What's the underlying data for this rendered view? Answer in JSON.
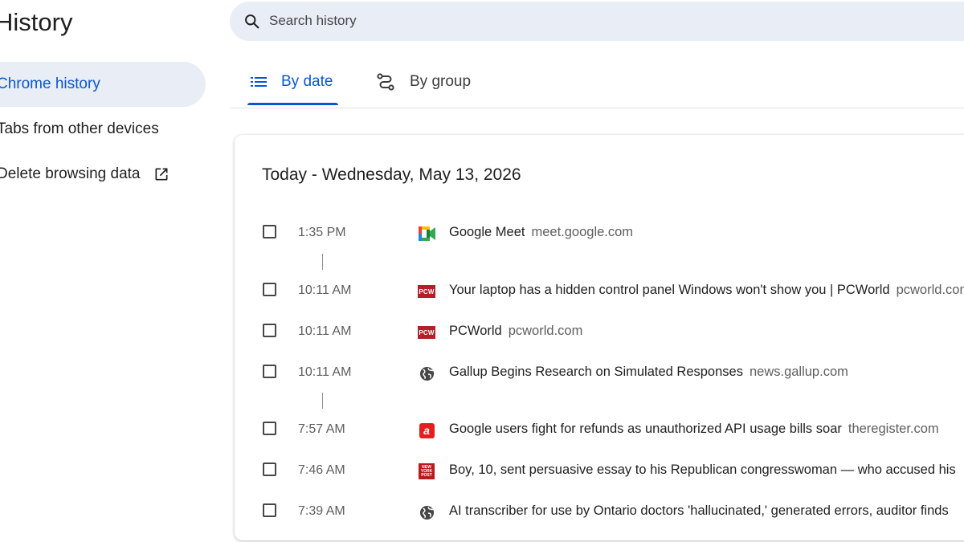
{
  "app": {
    "title": "History"
  },
  "sidebar": {
    "items": [
      {
        "label": "Chrome history",
        "active": true
      },
      {
        "label": "Tabs from other devices",
        "active": false
      },
      {
        "label": "Delete browsing data",
        "active": false,
        "icon": "open-in-new-icon"
      }
    ]
  },
  "search": {
    "placeholder": "Search history",
    "value": ""
  },
  "tabs": [
    {
      "label": "By date",
      "icon": "list-icon",
      "active": true
    },
    {
      "label": "By group",
      "icon": "route-icon",
      "active": false
    }
  ],
  "history": {
    "date_heading": "Today - Wednesday, May 13, 2026",
    "entries": [
      {
        "time": "1:35 PM",
        "title": "Google Meet",
        "domain": "meet.google.com",
        "favicon": "google-meet-icon"
      },
      {
        "time": "10:11 AM",
        "title": "Your laptop has a hidden control panel Windows won't show you | PCWorld",
        "domain": "pcworld.com",
        "favicon": "pcworld-icon"
      },
      {
        "time": "10:11 AM",
        "title": "PCWorld",
        "domain": "pcworld.com",
        "favicon": "pcworld-icon"
      },
      {
        "time": "10:11 AM",
        "title": "Gallup Begins Research on Simulated Responses",
        "domain": "news.gallup.com",
        "favicon": "globe-icon"
      },
      {
        "time": "7:57 AM",
        "title": "Google users fight for refunds as unauthorized API usage bills soar",
        "domain": "theregister.com",
        "favicon": "the-register-icon"
      },
      {
        "time": "7:46 AM",
        "title": "Boy, 10, sent persuasive essay to his Republican congresswoman — who accused his",
        "domain": "",
        "favicon": "new-york-post-icon"
      },
      {
        "time": "7:39 AM",
        "title": "AI transcriber for use by Ontario doctors 'hallucinated,' generated errors, auditor finds",
        "domain": "",
        "favicon": "globe-icon"
      }
    ]
  },
  "favicon_text": {
    "pcworld": "PCW",
    "register": "a",
    "nyp_1": "NEW",
    "nyp_2": "YORK",
    "nyp_3": "POST"
  },
  "colors": {
    "accent": "#0b57d0",
    "active_bg": "#e8edf6",
    "search_bg": "#e9eef6"
  }
}
